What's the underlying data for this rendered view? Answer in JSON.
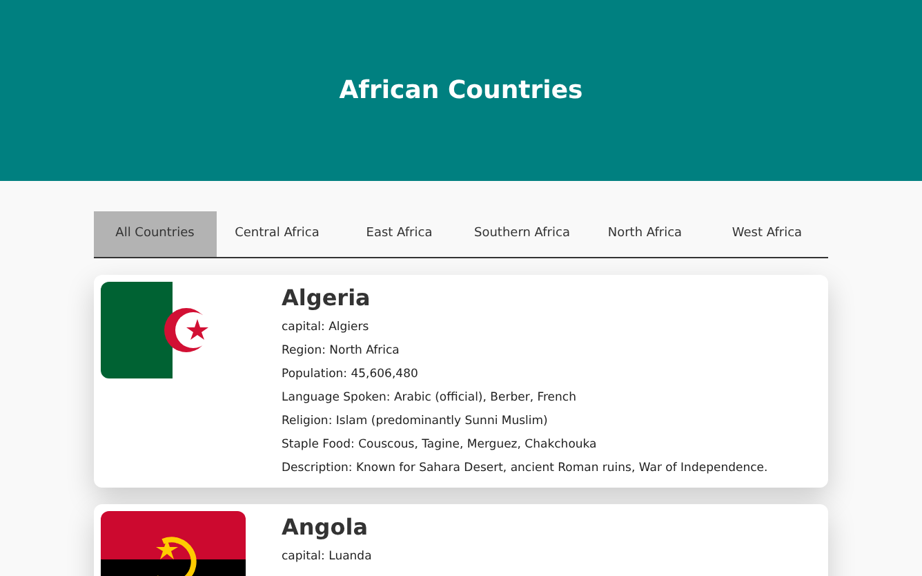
{
  "header": {
    "title": "African Countries"
  },
  "tabs": [
    {
      "label": "All Countries",
      "selected": true
    },
    {
      "label": "Central Africa",
      "selected": false
    },
    {
      "label": "East Africa",
      "selected": false
    },
    {
      "label": "Southern Africa",
      "selected": false
    },
    {
      "label": "North Africa",
      "selected": false
    },
    {
      "label": "West Africa",
      "selected": false
    }
  ],
  "countries": [
    {
      "name": "Algeria",
      "kind": "algeria",
      "details": [
        "capital: Algiers",
        "Region: North Africa",
        "Population: 45,606,480",
        "Language Spoken: Arabic (official), Berber, French",
        "Religion: Islam (predominantly Sunni Muslim)",
        "Staple Food: Couscous, Tagine, Merguez, Chakchouka",
        "Description: Known for Sahara Desert, ancient Roman ruins, War of Independence."
      ]
    },
    {
      "name": "Angola",
      "kind": "angola",
      "details": [
        "capital: Luanda"
      ]
    }
  ]
}
